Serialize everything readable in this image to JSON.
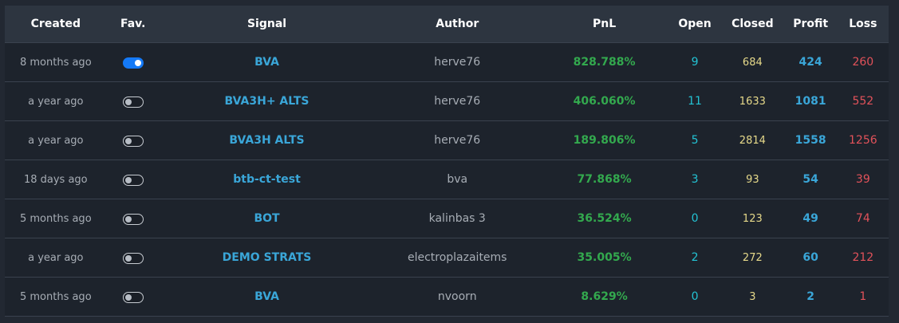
{
  "columns": {
    "created": "Created",
    "fav": "Fav.",
    "signal": "Signal",
    "author": "Author",
    "pnl": "PnL",
    "open": "Open",
    "closed": "Closed",
    "profit": "Profit",
    "loss": "Loss"
  },
  "rows": [
    {
      "created": "8 months ago",
      "fav": true,
      "signal": "BVA",
      "author": "herve76",
      "pnl": "828.788%",
      "open": "9",
      "closed": "684",
      "profit": "424",
      "loss": "260"
    },
    {
      "created": "a year ago",
      "fav": false,
      "signal": "BVA3H+ ALTS",
      "author": "herve76",
      "pnl": "406.060%",
      "open": "11",
      "closed": "1633",
      "profit": "1081",
      "loss": "552"
    },
    {
      "created": "a year ago",
      "fav": false,
      "signal": "BVA3H ALTS",
      "author": "herve76",
      "pnl": "189.806%",
      "open": "5",
      "closed": "2814",
      "profit": "1558",
      "loss": "1256"
    },
    {
      "created": "18 days ago",
      "fav": false,
      "signal": "btb-ct-test",
      "author": "bva",
      "pnl": "77.868%",
      "open": "3",
      "closed": "93",
      "profit": "54",
      "loss": "39"
    },
    {
      "created": "5 months ago",
      "fav": false,
      "signal": "BOT",
      "author": "kalinbas 3",
      "pnl": "36.524%",
      "open": "0",
      "closed": "123",
      "profit": "49",
      "loss": "74"
    },
    {
      "created": "a year ago",
      "fav": false,
      "signal": "DEMO STRATS",
      "author": "electroplazaitems",
      "pnl": "35.005%",
      "open": "2",
      "closed": "272",
      "profit": "60",
      "loss": "212"
    },
    {
      "created": "5 months ago",
      "fav": false,
      "signal": "BVA",
      "author": "nvoorn",
      "pnl": "8.629%",
      "open": "0",
      "closed": "3",
      "profit": "2",
      "loss": "1"
    }
  ],
  "colors": {
    "background": "#222832",
    "header": "#2d3540",
    "row": "#1d232c",
    "signal": "#3aa6d8",
    "pnl": "#33a94e",
    "open": "#23c3d4",
    "closed": "#e6d98a",
    "profit": "#3aa6d8",
    "loss": "#e2525a",
    "toggle_on": "#1479f6"
  }
}
